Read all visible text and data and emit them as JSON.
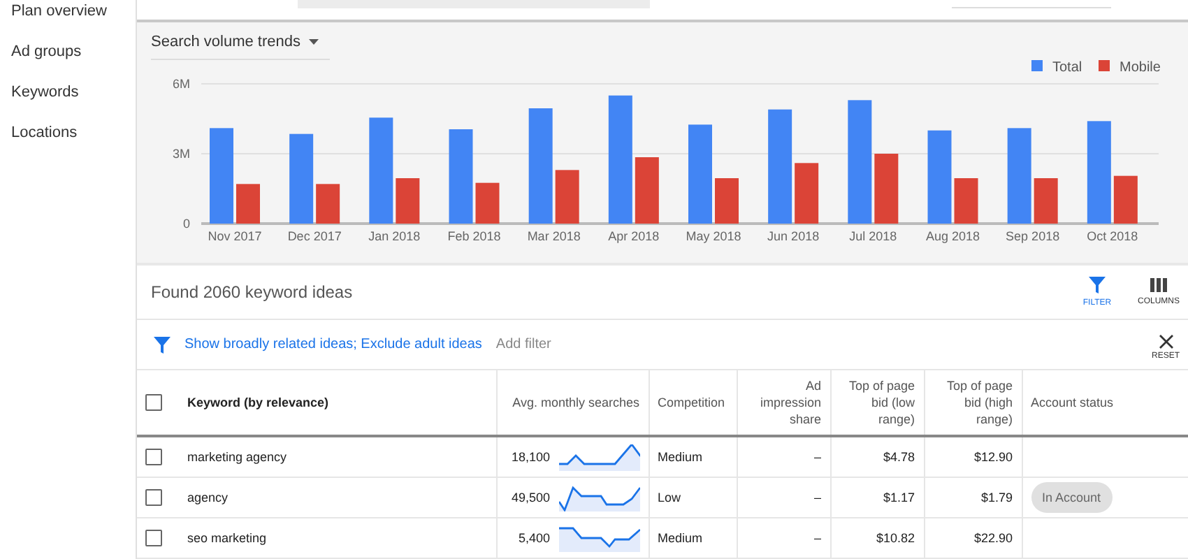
{
  "sidebar": {
    "items": [
      {
        "label": "Plan overview",
        "selected": false
      },
      {
        "label": "Ad groups",
        "selected": false
      },
      {
        "label": "Keywords",
        "selected": false
      },
      {
        "label": "Locations",
        "selected": false
      }
    ]
  },
  "trends": {
    "dropdown": "Search volume trends",
    "chart_data": {
      "type": "bar",
      "categories": [
        "Nov 2017",
        "Dec 2017",
        "Jan 2018",
        "Feb 2018",
        "Mar 2018",
        "Apr 2018",
        "May 2018",
        "Jun 2018",
        "Jul 2018",
        "Aug 2018",
        "Sep 2018",
        "Oct 2018"
      ],
      "series": [
        {
          "name": "Total",
          "color": "#4285f4",
          "values": [
            4100000,
            3850000,
            4550000,
            4050000,
            4950000,
            5500000,
            4250000,
            4900000,
            5300000,
            4000000,
            4100000,
            4400000
          ]
        },
        {
          "name": "Mobile",
          "color": "#db4437",
          "values": [
            1700000,
            1700000,
            1950000,
            1750000,
            2300000,
            2850000,
            1950000,
            2600000,
            3000000,
            1950000,
            1950000,
            2050000
          ]
        }
      ],
      "ylim": [
        0,
        6000000
      ],
      "legend": "top-right",
      "yticks": [
        {
          "value": 0,
          "label": "0"
        },
        {
          "value": 3000000,
          "label": "3M"
        },
        {
          "value": 6000000,
          "label": "6M"
        }
      ]
    }
  },
  "ideas": {
    "title": "Found 2060 keyword ideas",
    "tools": [
      {
        "kind": "filter",
        "label": "FILTER",
        "selected": true
      },
      {
        "kind": "columns",
        "label": "COLUMNS",
        "selected": false
      }
    ],
    "filter_text": "Show broadly related ideas; Exclude adult ideas",
    "add_filter": "Add filter",
    "reset": "RESET"
  },
  "table": {
    "header_checked": false,
    "columns": [
      "Keyword (by relevance)",
      "Avg. monthly searches",
      "Competition",
      "Ad impression share",
      "Top of page bid (low range)",
      "Top of page bid (high range)",
      "Account status"
    ],
    "rows": [
      {
        "checked": false,
        "keyword": "marketing agency",
        "searches": "18,100",
        "competition": "Medium",
        "impression_share": "–",
        "bid_low": "$4.78",
        "bid_high": "$12.90"
      },
      {
        "checked": false,
        "keyword": "agency",
        "searches": "49,500",
        "competition": "Low",
        "impression_share": "–",
        "bid_low": "$1.17",
        "bid_high": "$1.79",
        "account_status": "In Account"
      },
      {
        "checked": false,
        "keyword": "seo marketing",
        "searches": "5,400",
        "competition": "Medium",
        "impression_share": "–",
        "bid_low": "$10.82",
        "bid_high": "$22.90"
      }
    ]
  }
}
